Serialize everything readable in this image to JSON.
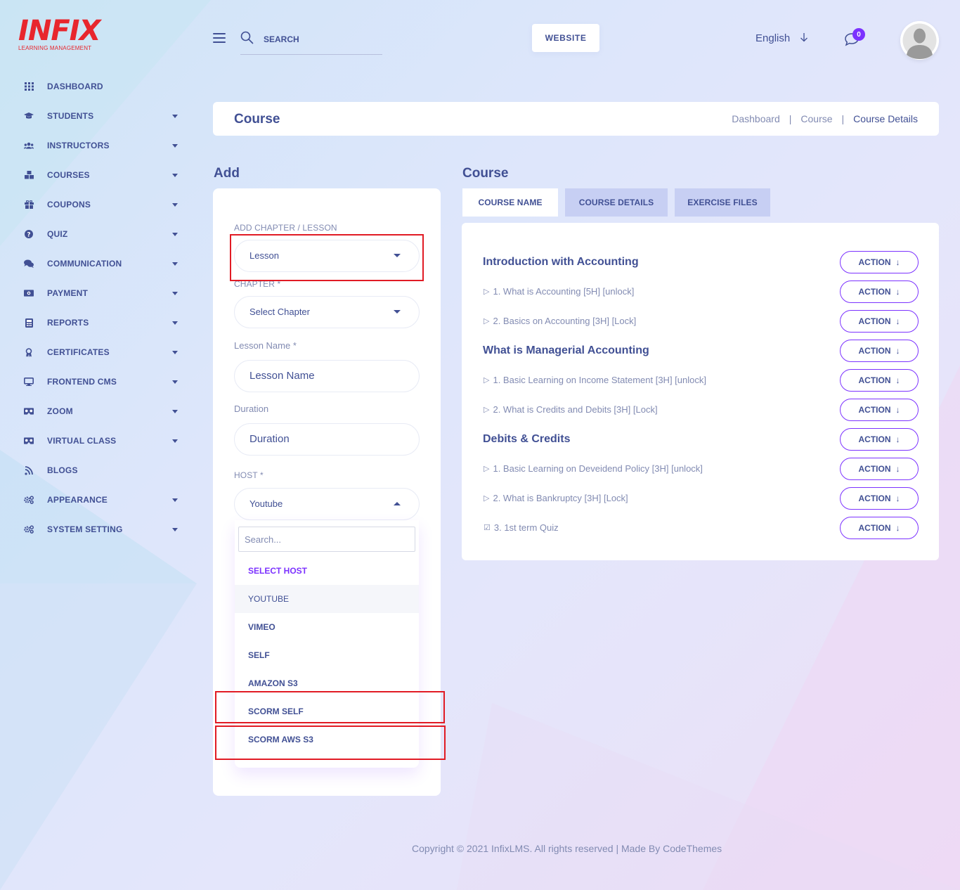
{
  "logo": {
    "main": "INFIX",
    "sub": "LEARNING MANAGEMENT"
  },
  "sidebar": {
    "items": [
      {
        "label": "DASHBOARD",
        "icon": "dashboard-grid-icon",
        "has_submenu": false
      },
      {
        "label": "STUDENTS",
        "icon": "graduation-cap-icon",
        "has_submenu": true
      },
      {
        "label": "INSTRUCTORS",
        "icon": "users-icon",
        "has_submenu": true
      },
      {
        "label": "COURSES",
        "icon": "cubes-icon",
        "has_submenu": true
      },
      {
        "label": "COUPONS",
        "icon": "gift-icon",
        "has_submenu": true
      },
      {
        "label": "QUIZ",
        "icon": "question-circle-icon",
        "has_submenu": true
      },
      {
        "label": "COMMUNICATION",
        "icon": "comments-icon",
        "has_submenu": true
      },
      {
        "label": "PAYMENT",
        "icon": "money-icon",
        "has_submenu": true
      },
      {
        "label": "REPORTS",
        "icon": "calculator-icon",
        "has_submenu": true
      },
      {
        "label": "CERTIFICATES",
        "icon": "award-icon",
        "has_submenu": true
      },
      {
        "label": "FRONTEND CMS",
        "icon": "desktop-icon",
        "has_submenu": true
      },
      {
        "label": "ZOOM",
        "icon": "vr-headset-icon",
        "has_submenu": true
      },
      {
        "label": "VIRTUAL CLASS",
        "icon": "vr-headset-icon",
        "has_submenu": true
      },
      {
        "label": "BLOGS",
        "icon": "blog-icon",
        "has_submenu": false
      },
      {
        "label": "APPEARANCE",
        "icon": "cogs-icon",
        "has_submenu": true
      },
      {
        "label": "SYSTEM SETTING",
        "icon": "cogs-icon",
        "has_submenu": true
      }
    ]
  },
  "header": {
    "search_placeholder": "SEARCH",
    "website_label": "WEBSITE",
    "language": "English",
    "notification_count": "0"
  },
  "title_bar": {
    "title": "Course",
    "breadcrumb": [
      "Dashboard",
      "Course",
      "Course Details"
    ]
  },
  "add_panel": {
    "section_title": "Add",
    "type_label": "ADD CHAPTER / LESSON",
    "type_value": "Lesson",
    "chapter_label": "CHAPTER *",
    "chapter_value": "Select Chapter",
    "lesson_name_label": "Lesson Name *",
    "lesson_name_placeholder": "Lesson Name",
    "duration_label": "Duration",
    "duration_placeholder": "Duration",
    "host_label": "HOST *",
    "host_value": "Youtube",
    "dropdown": {
      "search_placeholder": "Search...",
      "options": [
        "SELECT HOST",
        "YOUTUBE",
        "VIMEO",
        "SELF",
        "AMAZON S3",
        "SCORM SELF",
        "SCORM AWS S3"
      ],
      "selected": "YOUTUBE"
    }
  },
  "course_panel": {
    "section_title": "Course",
    "tabs": [
      "COURSE NAME",
      "COURSE DETAILS",
      "EXERCISE FILES"
    ],
    "action_label": "ACTION",
    "rows": [
      {
        "kind": "chapter",
        "text": "Introduction with Accounting"
      },
      {
        "kind": "lesson",
        "text": "1. What is Accounting [5H] [unlock]"
      },
      {
        "kind": "lesson",
        "text": "2. Basics on Accounting [3H] [Lock]"
      },
      {
        "kind": "chapter",
        "text": "What is Managerial Accounting"
      },
      {
        "kind": "lesson",
        "text": "1. Basic Learning on Income Statement [3H] [unlock]"
      },
      {
        "kind": "lesson",
        "text": "2. What is Credits and Debits [3H] [Lock]"
      },
      {
        "kind": "chapter",
        "text": "Debits & Credits"
      },
      {
        "kind": "lesson",
        "text": "1. Basic Learning on Deveidend Policy [3H] [unlock]"
      },
      {
        "kind": "lesson",
        "text": "2. What is Bankruptcy [3H] [Lock]"
      },
      {
        "kind": "quiz",
        "text": "3. 1st term Quiz"
      }
    ]
  },
  "footer": {
    "text": "Copyright © 2021 InfixLMS. All rights reserved | Made By CodeThemes"
  },
  "colors": {
    "primary_text": "#415094",
    "accent": "#7c32ff",
    "muted": "#828bb2",
    "brand_red": "#e8262d",
    "highlight_red": "#e11b24"
  }
}
